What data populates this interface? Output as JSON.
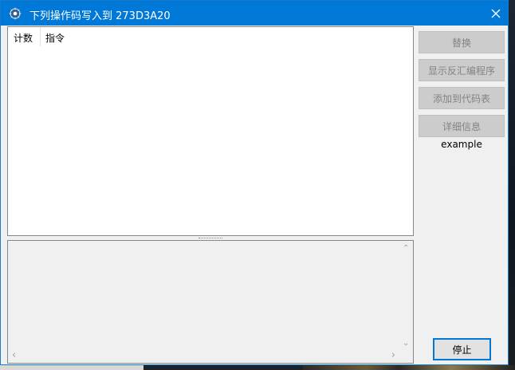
{
  "window": {
    "title": "下列操作码写入到 273D3A20"
  },
  "list": {
    "columns": [
      "计数",
      "指令"
    ],
    "rows": []
  },
  "sidebar": {
    "buttons": [
      {
        "label": "替换",
        "enabled": false
      },
      {
        "label": "显示反汇编程序",
        "enabled": false
      },
      {
        "label": "添加到代码表",
        "enabled": false
      },
      {
        "label": "详细信息",
        "enabled": false
      }
    ],
    "example_label": "example"
  },
  "footer": {
    "stop_label": "停止"
  },
  "colors": {
    "titlebar": "#0078d7",
    "window_bg": "#f0f0f0",
    "disabled_button": "#cccccc",
    "disabled_text": "#838383"
  }
}
